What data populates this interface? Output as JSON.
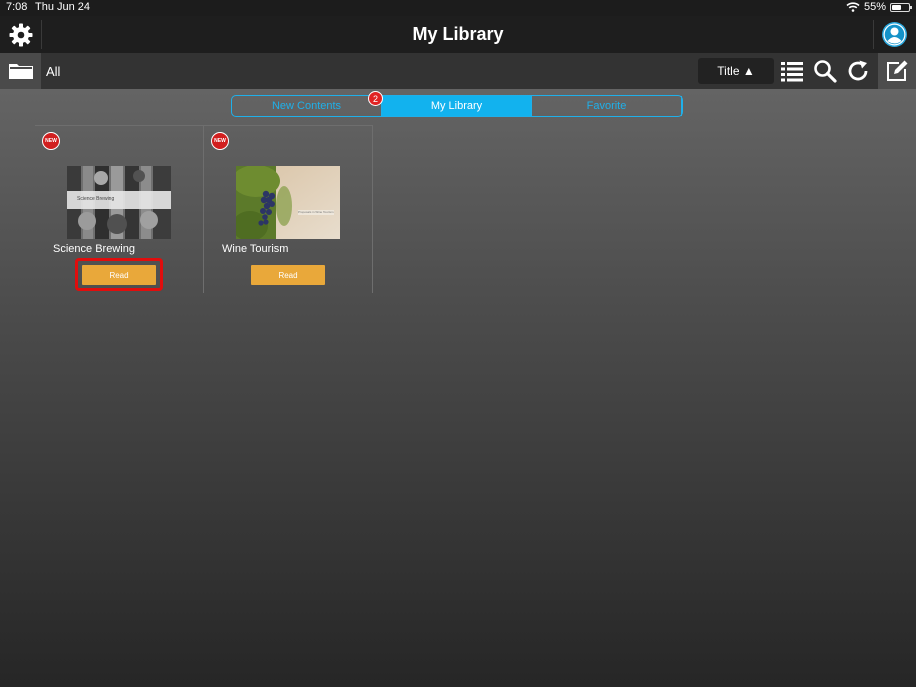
{
  "status": {
    "time": "7:08",
    "date": "Thu Jun 24",
    "battery": "55%",
    "battery_level": 0.55
  },
  "header": {
    "title": "My Library"
  },
  "toolbar": {
    "folder_label": "All",
    "sort_label": "Title ▲"
  },
  "tabs": [
    {
      "label": "New Contents",
      "active": false
    },
    {
      "label": "My Library",
      "active": true
    },
    {
      "label": "Favorite",
      "active": false
    }
  ],
  "tab_badge": "2",
  "books": [
    {
      "title": "Science Brewing",
      "badge": "NEW",
      "button": "Read",
      "cover_text": "Science Brewing"
    },
    {
      "title": "Wine Tourism",
      "badge": "NEW",
      "button": "Read",
      "cover_text": "Proposals in Wine Tourism"
    }
  ],
  "colors": {
    "accent": "#12b2ee",
    "read_button": "#e9a83a",
    "badge": "#d11f1f",
    "highlight": "#e10d0d"
  }
}
